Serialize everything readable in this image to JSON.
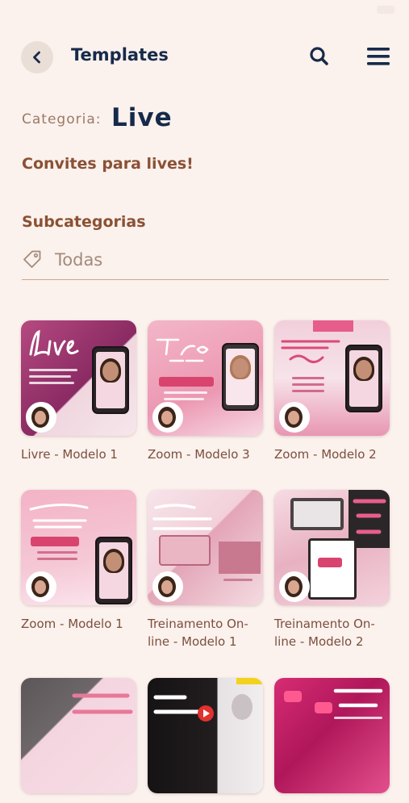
{
  "header": {
    "title": "Templates"
  },
  "category": {
    "label": "Categoria:",
    "value": "Live",
    "description": "Convites para lives!"
  },
  "subcategories": {
    "title": "Subcategorias",
    "selected": "Todas"
  },
  "templates": [
    {
      "name": "Livre - Modelo 1"
    },
    {
      "name": "Zoom - Modelo 3"
    },
    {
      "name": "Zoom - Modelo 2"
    },
    {
      "name": "Zoom - Modelo 1"
    },
    {
      "name": "Treinamento On-line - Modelo 1"
    },
    {
      "name": "Treinamento On-line - Modelo 2"
    },
    {
      "name": ""
    },
    {
      "name": ""
    },
    {
      "name": ""
    }
  ],
  "colors": {
    "background": "#fbf1ed",
    "navy": "#162a4a",
    "brown": "#8a5134",
    "muted": "#9b7a67",
    "pink": "#d9446e"
  },
  "icons": {
    "back": "chevron-left-icon",
    "search": "search-icon",
    "menu": "hamburger-menu-icon",
    "tag": "tag-icon"
  }
}
